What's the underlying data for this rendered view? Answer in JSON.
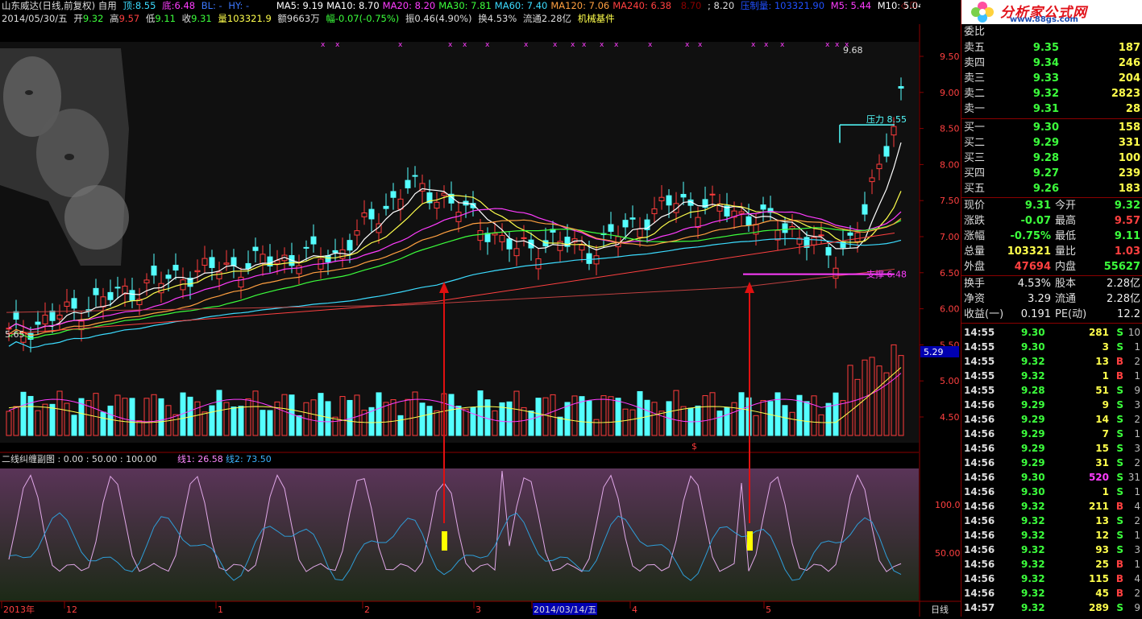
{
  "title": {
    "stock": "山东威达(日线,前复权) 自用",
    "top_label": "顶:",
    "top_val": "8.55",
    "bottom_label": "底:",
    "bottom_val": "6.48",
    "bl": "BL: -",
    "hy": "HY: -",
    "ma": [
      {
        "label": "MA5: 9.19",
        "color": "#ffffff"
      },
      {
        "label": "MA10: 8.70",
        "color": "#ffffff"
      },
      {
        "label": "MA20: 8.20",
        "color": "#ff3cff"
      },
      {
        "label": "MA30: 7.81",
        "color": "#3cff3c"
      },
      {
        "label": "MA60: 7.40",
        "color": "#3cdcff"
      },
      {
        "label": "MA120: 7.06",
        "color": "#ffa040"
      },
      {
        "label": "MA240: 6.38",
        "color": "#ff4040"
      }
    ],
    "extra1": "8.70",
    "extra2": "; 8.20",
    "extra3": "压制量: 103321.90",
    "m5": "M5: 5.44",
    "m10": "M10: 5.04"
  },
  "info": {
    "date": "2014/05/30/五",
    "open_lbl": "开",
    "open": "9.32",
    "high_lbl": "高",
    "high": "9.57",
    "low_lbl": "低",
    "low": "9.11",
    "close_lbl": "收",
    "close": "9.31",
    "vol_lbl": "量",
    "vol": "103321.9",
    "amt_lbl": "额",
    "amt": "9663万",
    "chg": "幅-0.07(-0.75%)",
    "amp": "振0.46(4.90%)",
    "turn": "换4.53%",
    "float": "流通2.28亿",
    "sector": "机械基件"
  },
  "price_axis": [
    "9.50",
    "9.00",
    "8.50",
    "8.00",
    "7.50",
    "7.00",
    "6.50",
    "6.00",
    "5.50",
    "5.00",
    "4.50"
  ],
  "vol_axis_badge": "5.29",
  "chart_labels": {
    "high_mark": "9.68",
    "low_mark": "5.65",
    "pressure": "压力 8.55",
    "support": "支撑 6.48",
    "dollar": "$"
  },
  "indicator": {
    "title": "二线纠缠副图 : 0.00 : 50.00 : 100.00",
    "line1": "线1: 26.58",
    "line2": "线2: 73.50",
    "axis": [
      "100.0",
      "50.00"
    ]
  },
  "time_axis": {
    "labels": [
      "2013年",
      "12",
      "1",
      "2",
      "3",
      "2014/03/14/五",
      "4",
      "5"
    ],
    "period": "日线"
  },
  "logo": {
    "text": "分析家公式网",
    "url": "www.88gs.com"
  },
  "orderbook": {
    "header": "委比",
    "sells": [
      {
        "label": "卖五",
        "price": "9.35",
        "vol": "187"
      },
      {
        "label": "卖四",
        "price": "9.34",
        "vol": "246"
      },
      {
        "label": "卖三",
        "price": "9.33",
        "vol": "204"
      },
      {
        "label": "卖二",
        "price": "9.32",
        "vol": "2823"
      },
      {
        "label": "卖一",
        "price": "9.31",
        "vol": "28"
      }
    ],
    "buys": [
      {
        "label": "买一",
        "price": "9.30",
        "vol": "158"
      },
      {
        "label": "买二",
        "price": "9.29",
        "vol": "331"
      },
      {
        "label": "买三",
        "price": "9.28",
        "vol": "100"
      },
      {
        "label": "买四",
        "price": "9.27",
        "vol": "239"
      },
      {
        "label": "买五",
        "price": "9.26",
        "vol": "183"
      }
    ]
  },
  "stats": [
    {
      "l1": "现价",
      "v1": "9.31",
      "c1": "green",
      "l2": "今开",
      "v2": "9.32",
      "c2": "green"
    },
    {
      "l1": "涨跌",
      "v1": "-0.07",
      "c1": "green",
      "l2": "最高",
      "v2": "9.57",
      "c2": "red"
    },
    {
      "l1": "涨幅",
      "v1": "-0.75%",
      "c1": "green",
      "l2": "最低",
      "v2": "9.11",
      "c2": "green"
    },
    {
      "l1": "总量",
      "v1": "103321",
      "c1": "yellow",
      "l2": "量比",
      "v2": "1.03",
      "c2": "red"
    },
    {
      "l1": "外盘",
      "v1": "47694",
      "c1": "red",
      "l2": "内盘",
      "v2": "55627",
      "c2": "green"
    }
  ],
  "stats2": [
    {
      "l1": "换手",
      "v1": "4.53%",
      "l2": "股本",
      "v2": "2.28亿"
    },
    {
      "l1": "净资",
      "v1": "3.29",
      "l2": "流通",
      "v2": "2.28亿"
    },
    {
      "l1": "收益(一)",
      "v1": "0.191",
      "l2": "PE(动)",
      "v2": "12.2"
    }
  ],
  "ticks": [
    {
      "t": "14:55",
      "p": "9.30",
      "v": "281",
      "bs": "S",
      "n": "10"
    },
    {
      "t": "14:55",
      "p": "9.30",
      "v": "3",
      "bs": "S",
      "n": "1"
    },
    {
      "t": "14:55",
      "p": "9.32",
      "v": "13",
      "bs": "B",
      "n": "2"
    },
    {
      "t": "14:55",
      "p": "9.32",
      "v": "1",
      "bs": "B",
      "n": "1"
    },
    {
      "t": "14:55",
      "p": "9.28",
      "v": "51",
      "bs": "S",
      "n": "9"
    },
    {
      "t": "14:56",
      "p": "9.29",
      "v": "9",
      "bs": "S",
      "n": "3"
    },
    {
      "t": "14:56",
      "p": "9.29",
      "v": "14",
      "bs": "S",
      "n": "2"
    },
    {
      "t": "14:56",
      "p": "9.29",
      "v": "7",
      "bs": "S",
      "n": "1"
    },
    {
      "t": "14:56",
      "p": "9.29",
      "v": "15",
      "bs": "S",
      "n": "3"
    },
    {
      "t": "14:56",
      "p": "9.29",
      "v": "31",
      "bs": "S",
      "n": "2"
    },
    {
      "t": "14:56",
      "p": "9.30",
      "v": "520",
      "bs": "S",
      "n": "31"
    },
    {
      "t": "14:56",
      "p": "9.30",
      "v": "1",
      "bs": "S",
      "n": "1"
    },
    {
      "t": "14:56",
      "p": "9.32",
      "v": "211",
      "bs": "B",
      "n": "4"
    },
    {
      "t": "14:56",
      "p": "9.32",
      "v": "13",
      "bs": "S",
      "n": "2"
    },
    {
      "t": "14:56",
      "p": "9.32",
      "v": "12",
      "bs": "S",
      "n": "1"
    },
    {
      "t": "14:56",
      "p": "9.32",
      "v": "93",
      "bs": "S",
      "n": "3"
    },
    {
      "t": "14:56",
      "p": "9.32",
      "v": "25",
      "bs": "B",
      "n": "1"
    },
    {
      "t": "14:56",
      "p": "9.32",
      "v": "115",
      "bs": "B",
      "n": "4"
    },
    {
      "t": "14:56",
      "p": "9.32",
      "v": "45",
      "bs": "B",
      "n": "2"
    },
    {
      "t": "14:57",
      "p": "9.32",
      "v": "289",
      "bs": "S",
      "n": "9"
    }
  ],
  "colors": {
    "up": "#ff3c3c",
    "down": "#54ffff",
    "bg": "#000000",
    "frame": "#8b0000"
  }
}
